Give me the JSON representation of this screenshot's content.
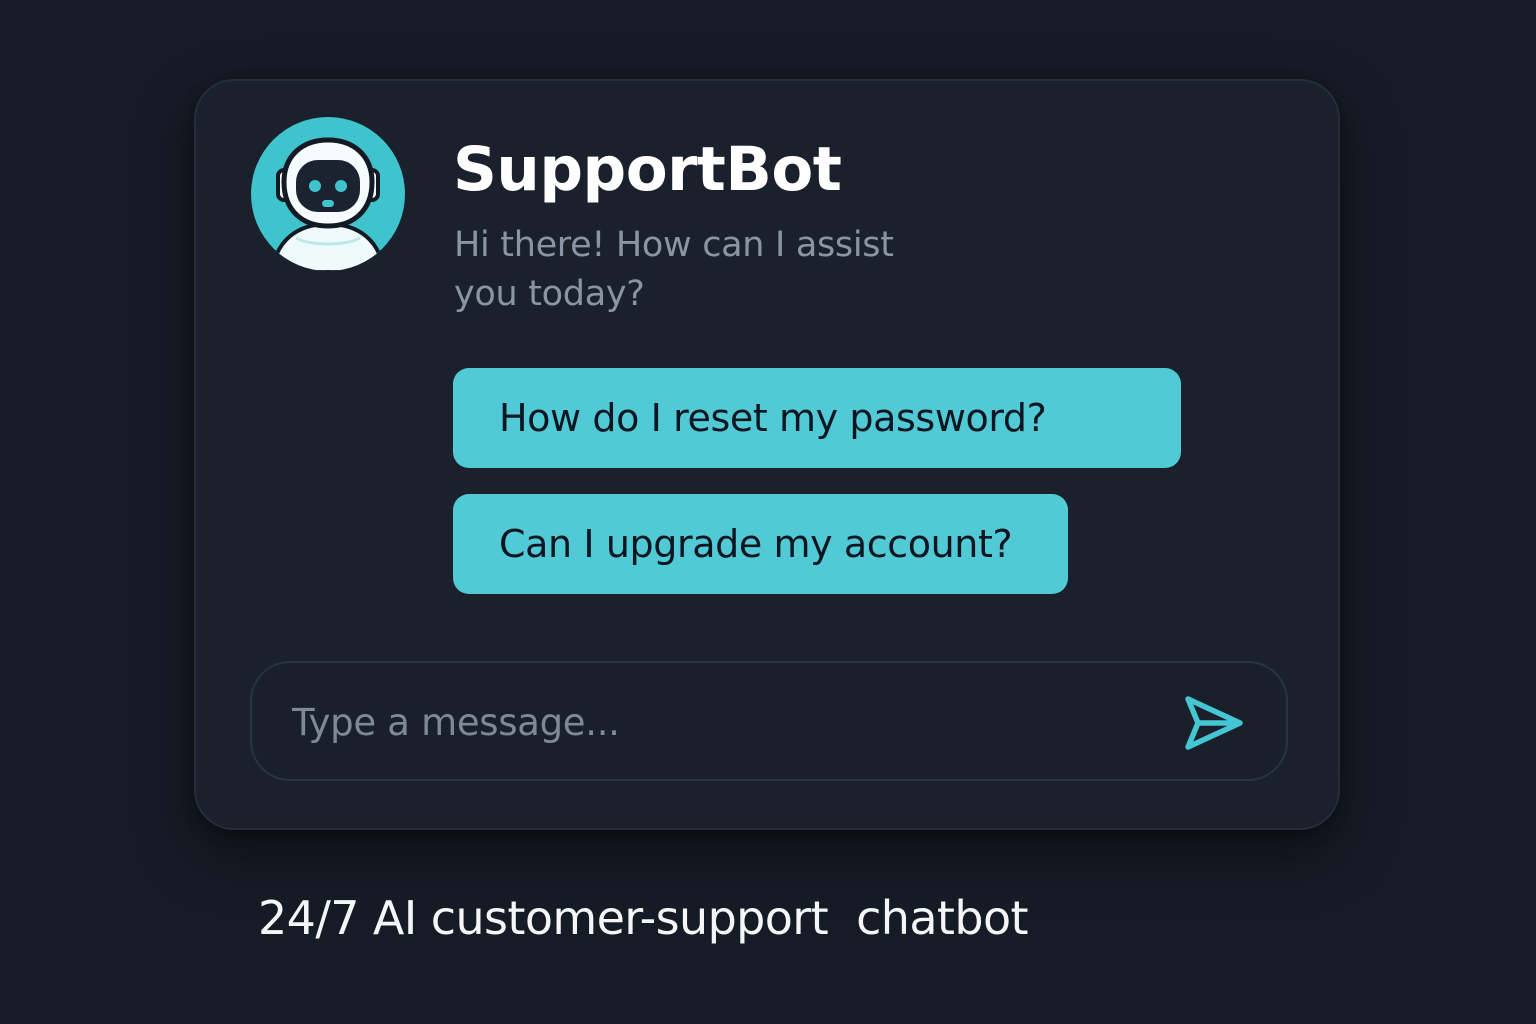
{
  "colors": {
    "background": "#161c26",
    "card": "#1a212c",
    "accent": "#51cad6",
    "title_text": "#ffffff",
    "muted_text": "#8a94a3"
  },
  "bot": {
    "name": "SupportBot",
    "greeting": "Hi there! How can I assist you today?",
    "avatar_icon": "robot-avatar-icon"
  },
  "suggestions": [
    {
      "label": "How do I reset my password?"
    },
    {
      "label": "Can I upgrade my account?"
    }
  ],
  "composer": {
    "placeholder": "Type a message...",
    "value": "",
    "send_icon": "send-icon"
  },
  "caption": "24/7 AI customer-support  chatbot"
}
